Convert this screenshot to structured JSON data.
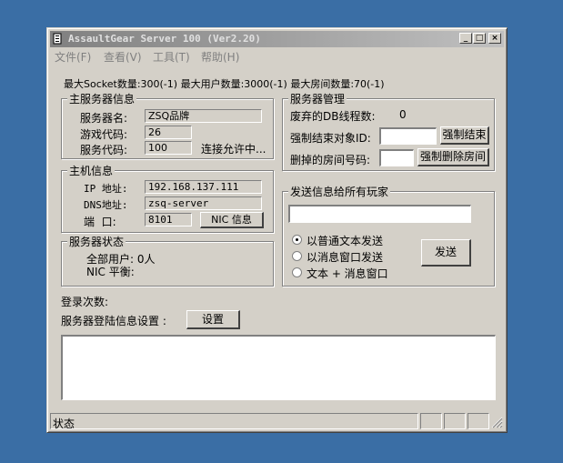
{
  "window": {
    "title": "AssaultGear Server 100 (Ver2.20)",
    "minimize_glyph": "_",
    "maximize_glyph": "□",
    "close_glyph": "×"
  },
  "menu": [
    {
      "label": "文件(F)"
    },
    {
      "label": "查看(V)"
    },
    {
      "label": "工具(T)"
    },
    {
      "label": "帮助(H)"
    }
  ],
  "summary": "最大Socket数量:300(-1) 最大用户数量:3000(-1) 最大房间数量:70(-1)",
  "main_server": {
    "title": "主服务器信息",
    "name_label": "服务器名:",
    "name_value": "ZSQ品牌",
    "game_code_label": "游戏代码:",
    "game_code_value": "26",
    "service_code_label": "服务代码:",
    "service_code_value": "100",
    "connect_status": "连接允许中..."
  },
  "host": {
    "title": "主机信息",
    "ip_label": "IP 地址:",
    "ip_value": "192.168.137.111",
    "dns_label": "DNS地址:",
    "dns_value": "zsq-server",
    "port_label": "端  口:",
    "port_value": "8101",
    "nic_button": "NIC 信息"
  },
  "status": {
    "title": "服务器状态",
    "all_users": "全部用户: 0人",
    "nic_balance": "NIC 平衡:"
  },
  "management": {
    "title": "服务器管理",
    "discarded_threads_label": "废弃的DB线程数:",
    "discarded_threads_value": "0",
    "force_end_label": "强制结束对象ID:",
    "force_end_value": "",
    "force_end_button": "强制结束",
    "delete_room_label": "删掉的房间号码:",
    "delete_room_value": "",
    "delete_room_button": "强制删除房间"
  },
  "broadcast": {
    "title": "发送信息给所有玩家",
    "message_value": "",
    "options": [
      {
        "label": "以普通文本发送",
        "selected": true
      },
      {
        "label": "以消息窗口发送",
        "selected": false
      },
      {
        "label": "文本 + 消息窗口",
        "selected": false
      }
    ],
    "send_button": "发送"
  },
  "login_count_label": "登录次数:",
  "login_settings_label": "服务器登陆信息设置 :",
  "settings_button": "设置",
  "statusbar": {
    "text": "状态"
  },
  "colors": {
    "desktop": "#3a6ea5",
    "face": "#d4d0c8",
    "title_inactive_start": "#808080",
    "title_inactive_end": "#c0c0c0"
  }
}
